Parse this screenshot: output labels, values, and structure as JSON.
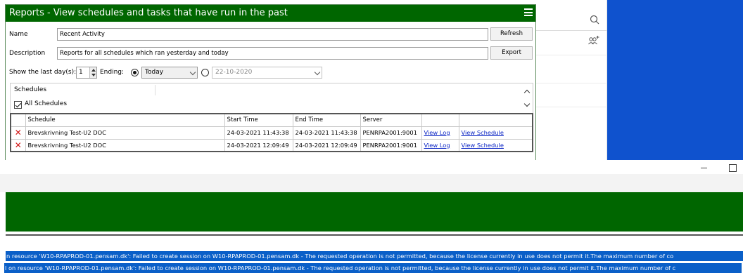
{
  "dialog": {
    "title": "Reports - View schedules and tasks that have run in the past",
    "name_label": "Name",
    "name_value": "Recent Activity",
    "description_label": "Description",
    "description_value": "Reports for all schedules which ran yesterday and today",
    "refresh_label": "Refresh",
    "export_label": "Export",
    "show_last_days_label": "Show the last day(s):",
    "days_value": "1",
    "ending_label": "Ending:",
    "ending_option_today": "Today",
    "ending_date_value": "22-10-2020",
    "schedules_header": "Schedules",
    "all_schedules_label": "All Schedules",
    "table": {
      "columns": [
        "Schedule",
        "Start Time",
        "End Time",
        "Server",
        "",
        ""
      ],
      "rows": [
        {
          "schedule": "Brevskrivning Test-U2 DOC",
          "start": "24-03-2021 11:43:38",
          "end": "24-03-2021 11:43:38",
          "server": "PENRPA2001:9001",
          "log_link": "View Log",
          "schedule_link": "View Schedule"
        },
        {
          "schedule": "Brevskrivning Test-U2 DOC",
          "start": "24-03-2021 12:09:49",
          "end": "24-03-2021 12:09:49",
          "server": "PENRPA2001:9001",
          "log_link": "View Log",
          "schedule_link": "View Schedule"
        }
      ]
    }
  },
  "log": {
    "line1": "n resource 'W10-RPAPROD-01.pensam.dk': Failed to create session on W10-RPAPROD-01.pensam.dk - The requested operation is not permitted, because the license currently in use does not permit it.The maximum number of co",
    "line2": "l on resource 'W10-RPAPROD-01.pensam.dk': Failed to create session on W10-RPAPROD-01.pensam.dk - The requested operation is not permitted, because the license currently in use does not permit it.The maximum number of c"
  },
  "colors": {
    "title_green": "#006600",
    "background_blue": "#0f52ce",
    "log_highlight": "#0a5fc8",
    "error_red": "#d21818",
    "link_blue": "#0a24c4"
  }
}
